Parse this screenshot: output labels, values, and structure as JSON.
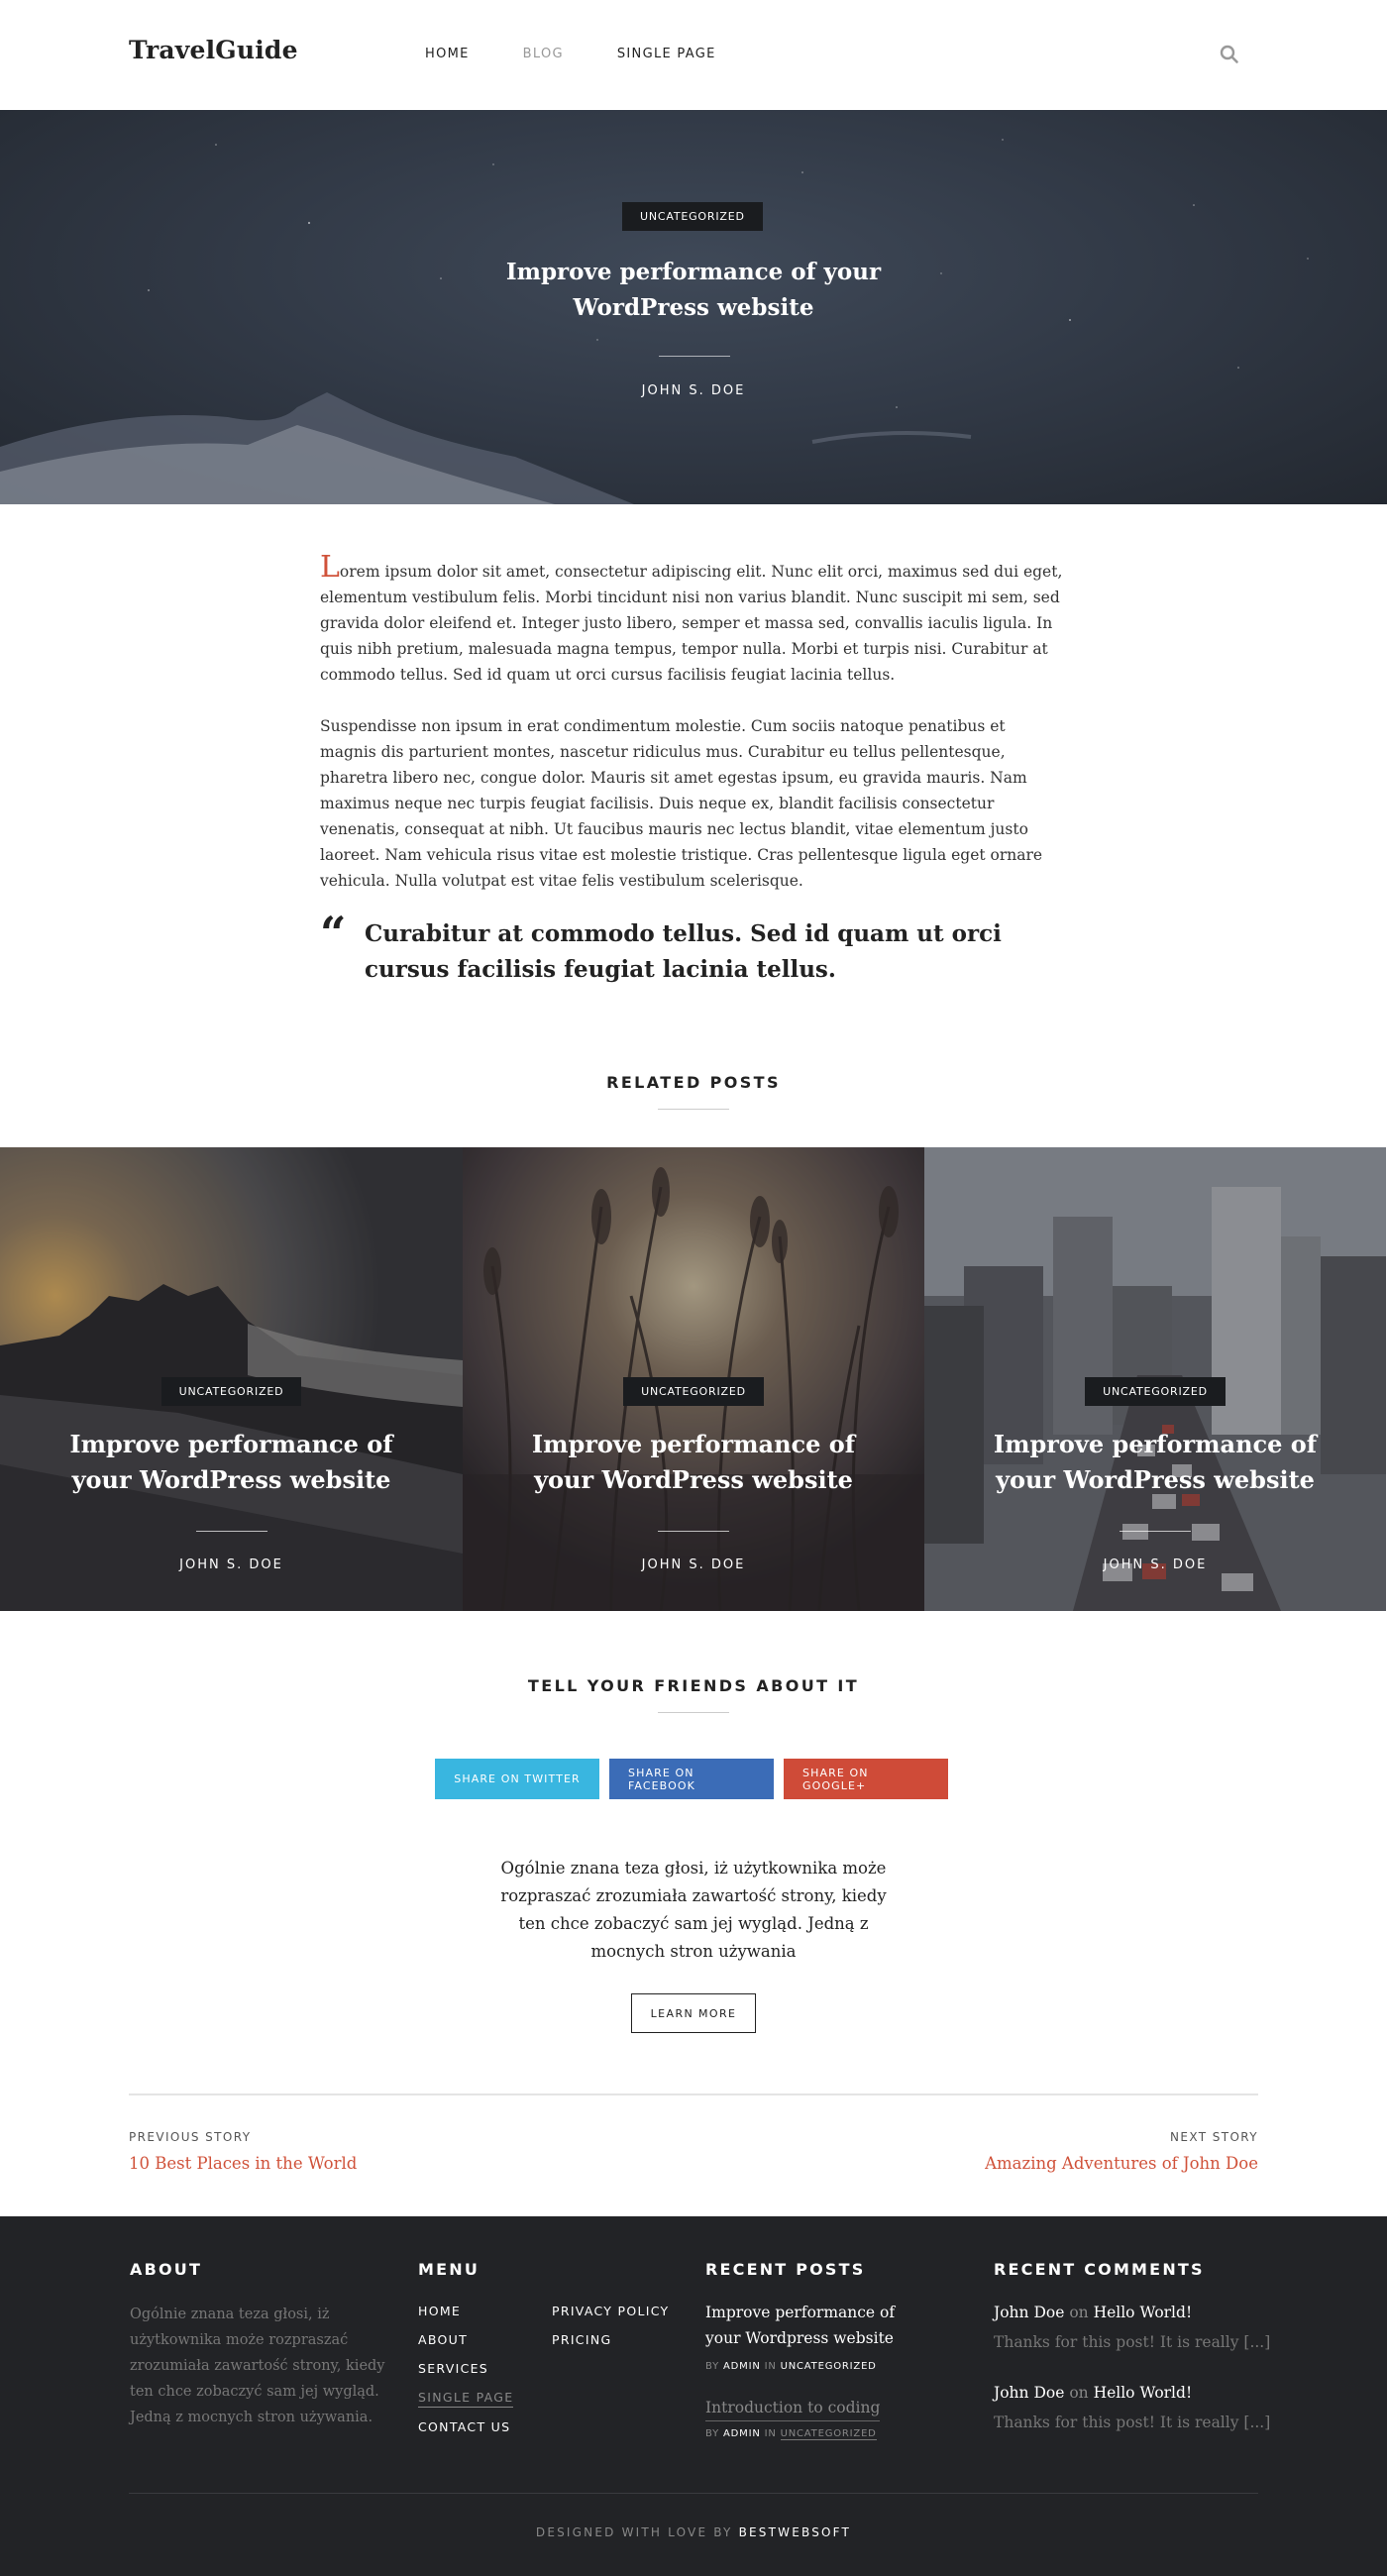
{
  "header": {
    "logo": "TravelGuide",
    "nav": [
      "HOME",
      "BLOG",
      "SINGLE PAGE"
    ],
    "active_nav": "BLOG",
    "search_icon": "search-icon"
  },
  "hero": {
    "category": "UNCATEGORIZED",
    "title": "Improve performance of your WordPress website",
    "author": "JOHN S. DOE"
  },
  "article": {
    "dropcap": "L",
    "paragraph1": "orem ipsum dolor sit amet, consectetur adipiscing elit. Nunc elit orci, maximus sed dui eget, elementum vestibulum felis. Morbi tincidunt nisi non varius blandit. Nunc suscipit mi sem, sed gravida dolor eleifend et. Integer justo libero, semper et massa sed, convallis iaculis ligula. In quis nibh pretium, malesuada magna tempus, tempor nulla. Morbi et turpis nisi. Curabitur at commodo tellus. Sed id quam ut orci cursus facilisis feugiat lacinia tellus.",
    "paragraph2": "Suspendisse non ipsum in erat condimentum molestie. Cum sociis natoque penatibus et magnis dis parturient montes, nascetur ridiculus mus. Curabitur eu tellus pellentesque, pharetra libero nec, congue dolor. Mauris sit amet egestas ipsum, eu gravida mauris. Nam maximus neque nec turpis feugiat facilisis. Duis neque ex, blandit facilisis consectetur venenatis, consequat at nibh. Ut faucibus mauris nec lectus blandit, vitae elementum justo laoreet. Nam vehicula risus vitae est molestie tristique. Cras pellentesque ligula eget ornare vehicula. Nulla volutpat est vitae felis vestibulum scelerisque.",
    "quote_mark": "“",
    "quote": "Curabitur at commodo tellus. Sed id quam ut orci cursus facilisis feugiat lacinia tellus."
  },
  "related": {
    "heading": "RELATED POSTS",
    "posts": [
      {
        "category": "UNCATEGORIZED",
        "title": "Improve performance of your WordPress website",
        "author": "JOHN S. DOE"
      },
      {
        "category": "UNCATEGORIZED",
        "title": "Improve performance of your WordPress website",
        "author": "JOHN S. DOE"
      },
      {
        "category": "UNCATEGORIZED",
        "title": "Improve performance of your WordPress website",
        "author": "JOHN S. DOE"
      }
    ]
  },
  "share": {
    "heading": "TELL YOUR FRIENDS ABOUT IT",
    "twitter": "SHARE ON TWITTER",
    "facebook": "SHARE ON FACEBOOK",
    "google": "SHARE ON GOOGLE+",
    "blurb": "Ogólnie znana teza głosi, iż użytkownika może rozpraszać zrozumiała zawartość strony, kiedy ten chce zobaczyć sam jej wygląd. Jedną z mocnych stron używania",
    "learn_more": "LEARN MORE"
  },
  "post_nav": {
    "prev_label": "PREVIOUS STORY",
    "prev_title": "10 Best Places in the World",
    "next_label": "NEXT STORY",
    "next_title": "Amazing Adventures of John Doe"
  },
  "footer": {
    "about_heading": "ABOUT",
    "about_text": "Ogólnie znana teza głosi, iż użytkownika może rozpraszać zrozumiała zawartość strony, kiedy ten chce zobaczyć sam jej wygląd. Jedną z mocnych stron używania.",
    "menu_heading": "MENU",
    "menu_col1": [
      "HOME",
      "ABOUT",
      "SERVICES",
      "SINGLE PAGE",
      "CONTACT US"
    ],
    "menu_col2": [
      "PRIVACY POLICY",
      "PRICING"
    ],
    "recent_posts_heading": "RECENT POSTS",
    "recent_posts": [
      {
        "title": "Improve performance of your Wordpress website",
        "by": "BY",
        "author": "ADMIN",
        "in": "IN",
        "category": "UNCATEGORIZED"
      },
      {
        "title": "Introduction to coding",
        "by": "BY",
        "author": "ADMIN",
        "in": "IN",
        "category": "UNCATEGORIZED"
      }
    ],
    "recent_comments_heading": "RECENT COMMENTS",
    "recent_comments": [
      {
        "author": "John Doe",
        "on": "on",
        "post": "Hello World!",
        "excerpt": "Thanks for this post! It is really [...]"
      },
      {
        "author": "John Doe",
        "on": "on",
        "post": "Hello World!",
        "excerpt": "Thanks for this post! It is really [...]"
      }
    ],
    "credit_prefix": "DESIGNED WITH LOVE BY",
    "credit_brand": "BESTWEBSOFT"
  },
  "colors": {
    "accent": "#d0523a",
    "twitter": "#39b6e0",
    "facebook": "#3b6cb7",
    "google": "#cf4b38",
    "footer_bg": "#222326"
  }
}
